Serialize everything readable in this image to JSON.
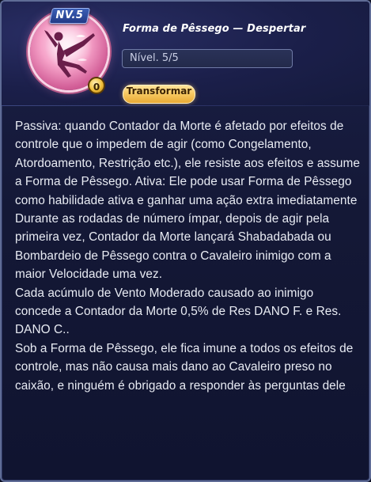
{
  "skill": {
    "level_badge": "NV.5",
    "star_count": "0",
    "title": "Forma de Pêssego — Despertar",
    "level_text": "Nível. 5/5",
    "transform_label": "Transformar"
  },
  "description": {
    "text": "Passiva: quando Contador da Morte é afetado por efeitos de controle que o impedem de agir (como Congelamento, Atordoamento, Restrição etc.), ele resiste aos efeitos e assume a Forma de Pêssego. Ativa: Ele pode usar Forma de Pêssego como habilidade ativa e ganhar uma ação extra imediatamente\nDurante as rodadas de número ímpar, depois de agir pela primeira vez, Contador da Morte lançará Shabadabada ou Bombardeio de Pêssego contra o Cavaleiro inimigo com a maior Velocidade uma vez.\nCada acúmulo de Vento Moderado causado ao inimigo concede a Contador da Morte 0,5% de Res DANO F. e Res. DANO C..\nSob a Forma de Pêssego, ele fica imune a todos os efeitos de controle, mas não causa mais dano ao Cavaleiro preso no caixão, e ninguém é obrigado a responder às perguntas dele"
  },
  "colors": {
    "panel_bg": "#141836",
    "accent_gold": "#f6c75f",
    "portrait_pink": "#f6a3c9",
    "text": "#e8ebf3"
  }
}
